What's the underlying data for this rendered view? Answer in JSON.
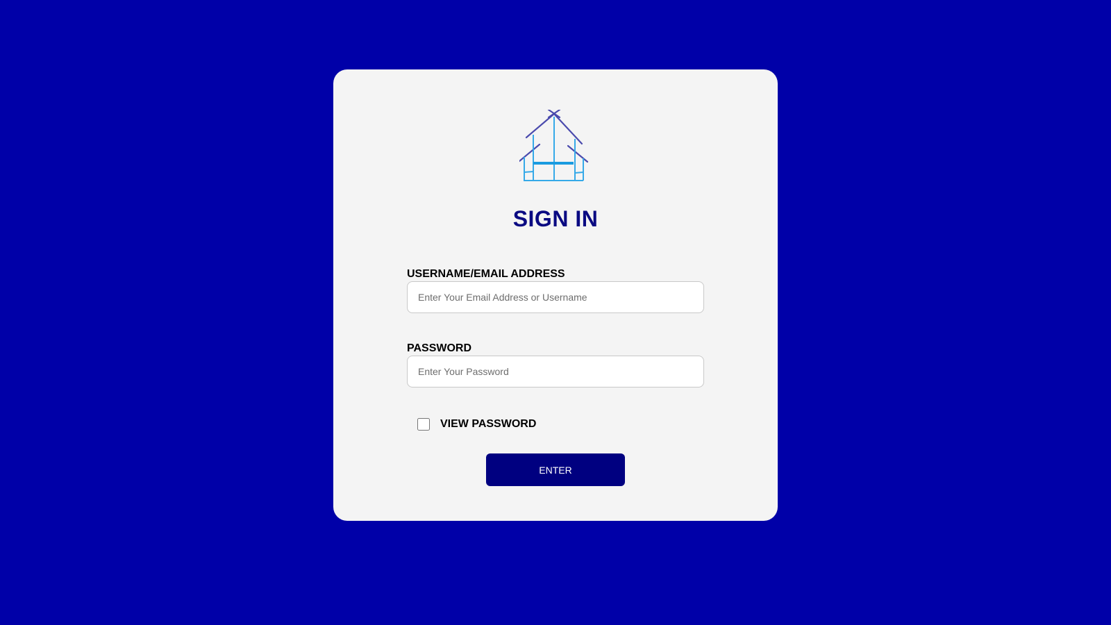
{
  "logo": {
    "icon": "house-icon",
    "colors": {
      "roof": "#4a4aad",
      "frame": "#35a9e8",
      "beam": "#1a9be0"
    }
  },
  "signin": {
    "title": "SIGN IN",
    "username_label": "USERNAME/EMAIL ADDRESS",
    "username_placeholder": "Enter Your Email Address or Username",
    "username_value": "",
    "password_label": "PASSWORD",
    "password_placeholder": "Enter Your Password",
    "password_value": "",
    "view_password_label": "VIEW PASSWORD",
    "view_password_checked": false,
    "enter_label": "ENTER"
  },
  "colors": {
    "background": "#0000a8",
    "card": "#f4f4f4",
    "title": "#0a0a82",
    "button": "#000080"
  }
}
